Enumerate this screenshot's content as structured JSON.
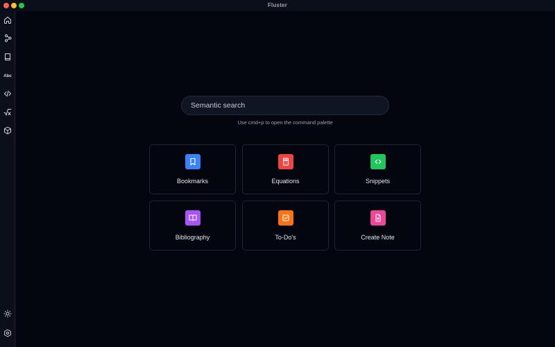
{
  "window": {
    "title": "Fluster"
  },
  "sidebar": {
    "items": [
      {
        "name": "home",
        "icon": "home-icon"
      },
      {
        "name": "network",
        "icon": "nodes-icon"
      },
      {
        "name": "notes",
        "icon": "book-icon"
      },
      {
        "name": "dictionary",
        "icon": "abc-icon",
        "text": "Abc"
      },
      {
        "name": "snippets",
        "icon": "code-icon"
      },
      {
        "name": "equations",
        "icon": "sqrt-icon"
      },
      {
        "name": "cube",
        "icon": "cube-icon"
      }
    ],
    "bottom": [
      {
        "name": "theme",
        "icon": "sun-icon"
      },
      {
        "name": "settings",
        "icon": "settings-icon"
      }
    ]
  },
  "search": {
    "placeholder": "Semantic search",
    "hint": "Use cmd+p to open the command palette"
  },
  "cards": [
    {
      "label": "Bookmarks",
      "icon": "bookmark-icon",
      "color": "#3b82f6"
    },
    {
      "label": "Equations",
      "icon": "calculator-icon",
      "color": "#ef4444"
    },
    {
      "label": "Snippets",
      "icon": "code-icon",
      "color": "#22c55e"
    },
    {
      "label": "Bibliography",
      "icon": "open-book-icon",
      "color": "#a855f7"
    },
    {
      "label": "To-Do's",
      "icon": "checkbox-icon",
      "color": "#f97316"
    },
    {
      "label": "Create Note",
      "icon": "file-plus-icon",
      "color": "#ec4899"
    }
  ]
}
